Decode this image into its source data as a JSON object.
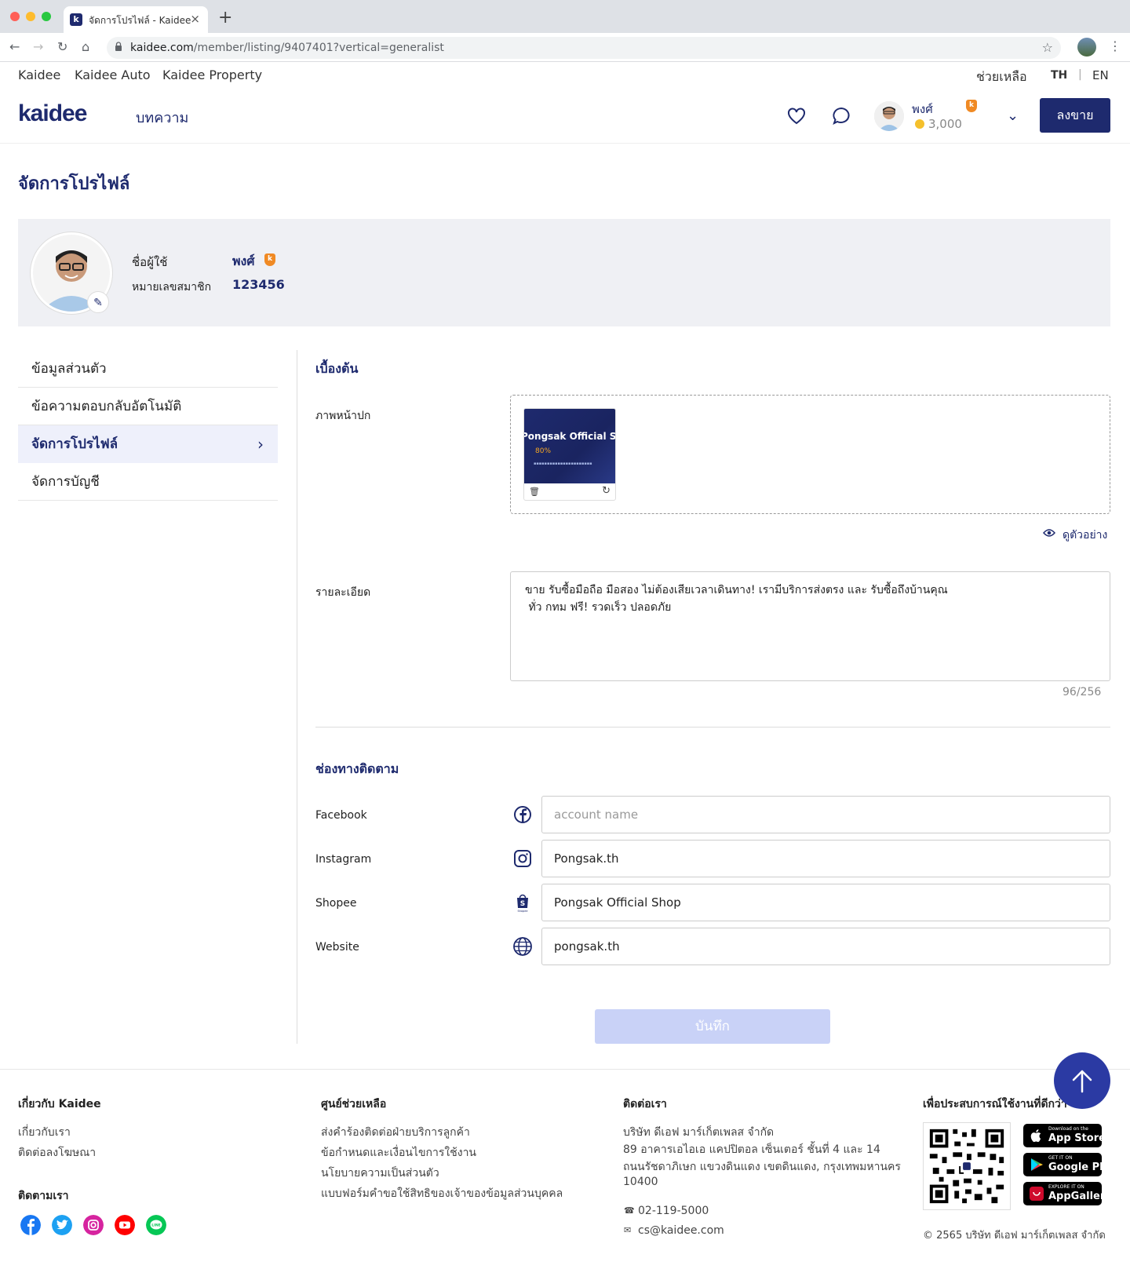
{
  "browser": {
    "tab_title": "จัดการโปรไฟล์ - Kaidee",
    "tab_favicon": "k",
    "url_host": "kaidee.com",
    "url_path": "/member/listing/9407401?vertical=generalist"
  },
  "topnav": {
    "links": [
      "Kaidee",
      "Kaidee Auto",
      "Kaidee Property"
    ],
    "help": "ช่วยเหลือ",
    "lang_th": "TH",
    "lang_sep": "|",
    "lang_en": "EN"
  },
  "header": {
    "logo": "kaidee",
    "articles": "บทความ",
    "user_name": "พงศ์",
    "coins": "3,000",
    "badge": "k",
    "sell_button": "ลงขาย"
  },
  "page_title": "จัดการโปรไฟล์",
  "profile": {
    "username_label": "ชื่อผู้ใช้",
    "username": "พงศ์",
    "member_id_label": "หมายเลขสมาชิก",
    "member_id": "123456"
  },
  "sidebar": {
    "items": [
      {
        "label": "ข้อมูลส่วนตัว"
      },
      {
        "label": "ข้อความตอบกลับอัตโนมัติ"
      },
      {
        "label": "จัดการโปรไฟล์"
      },
      {
        "label": "จัดการบัญชี"
      }
    ],
    "active_index": 2
  },
  "basic": {
    "title": "เบื้องต้น",
    "cover_label": "ภาพหน้าปก",
    "cover_thumb_title": "Pongsak Official Shop",
    "cover_thumb_promo": "80%",
    "preview": "ดูตัวอย่าง",
    "description_label": "รายละเอียด",
    "description": "ขาย รับซื้อมือถือ มือสอง ไม่ต้องเสียเวลาเดินทาง! เรามีบริการส่งตรง และ รับซื้อถึงบ้านคุณ\n ทั่ว กทม ฟรี! รวดเร็ว ปลอดภัย",
    "counter": "96/256"
  },
  "social": {
    "title": "ช่องทางติดตาม",
    "fields": [
      {
        "label": "Facebook",
        "icon": "facebook-icon",
        "value": "",
        "placeholder": "account name"
      },
      {
        "label": "Instagram",
        "icon": "instagram-icon",
        "value": "Pongsak.th",
        "placeholder": ""
      },
      {
        "label": "Shopee",
        "icon": "shopee-icon",
        "value": "Pongsak Official Shop",
        "placeholder": ""
      },
      {
        "label": "Website",
        "icon": "globe-icon",
        "value": "pongsak.th",
        "placeholder": ""
      }
    ],
    "save_button": "บันทึก"
  },
  "footer": {
    "about": {
      "title": "เกี่ยวกับ Kaidee",
      "links": [
        "เกี่ยวกับเรา",
        "ติดต่อลงโฆษณา"
      ]
    },
    "follow_title": "ติดตามเรา",
    "help": {
      "title": "ศูนย์ช่วยเหลือ",
      "links": [
        "ส่งคำร้องติดต่อฝ่ายบริการลูกค้า",
        "ข้อกำหนดและเงื่อนไขการใช้งาน",
        "นโยบายความเป็นส่วนตัว",
        "แบบฟอร์มคำขอใช้สิทธิของเจ้าของข้อมูลส่วนบุคคล"
      ]
    },
    "contact": {
      "title": "ติดต่อเรา",
      "address": [
        "บริษัท ดีเอฟ มาร์เก็ตเพลส จำกัด",
        "89 อาคารเอไอเอ แคปปิตอล เซ็นเตอร์ ชั้นที่ 4 และ 14",
        "ถนนรัชดาภิเษก แขวงดินแดง เขตดินแดง, กรุงเทพมหานคร",
        "10400"
      ],
      "phone": "02-119-5000",
      "email": "cs@kaidee.com"
    },
    "app": {
      "title": "เพื่อประสบการณ์ใช้งานที่ดีกว่า",
      "stores": [
        {
          "small": "Download on the",
          "large": "App Store"
        },
        {
          "small": "GET IT ON",
          "large": "Google Play"
        },
        {
          "small": "EXPLORE IT ON",
          "large": "AppGallery"
        }
      ]
    },
    "copyright": "© 2565 บริษัท ดีเอฟ มาร์เก็ตเพลส จำกัด"
  },
  "colors": {
    "brand": "#1e2a6e",
    "accent_orange": "#f08a24",
    "save_disabled": "#c9d2f7",
    "fab": "#2b3aa3"
  }
}
